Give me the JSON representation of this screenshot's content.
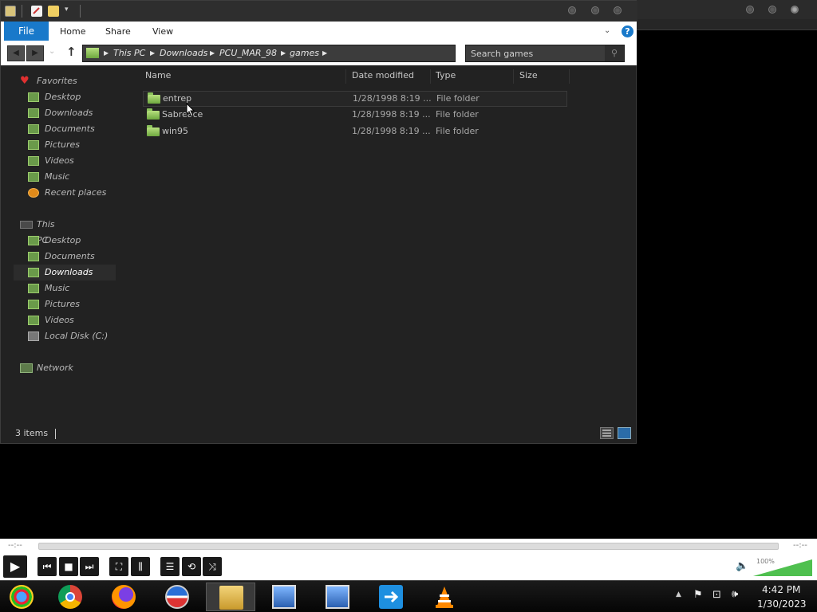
{
  "ribbon": {
    "file_tab": "File",
    "tabs": [
      "Home",
      "Share",
      "View"
    ],
    "help": "?"
  },
  "address": {
    "crumbs": [
      "This PC",
      "Downloads",
      "PCU_MAR_98",
      "games"
    ]
  },
  "search": {
    "placeholder": "Search games"
  },
  "nav": {
    "favorites_label": "Favorites",
    "favorites": [
      "Desktop",
      "Downloads",
      "Documents",
      "Pictures",
      "Videos",
      "Music",
      "Recent places"
    ],
    "thispc_label": "This PC",
    "thispc": [
      "Desktop",
      "Documents",
      "Downloads",
      "Music",
      "Pictures",
      "Videos",
      "Local Disk (C:)"
    ],
    "network_label": "Network",
    "selected": "Downloads"
  },
  "columns": {
    "name": "Name",
    "date": "Date modified",
    "type": "Type",
    "size": "Size"
  },
  "files": [
    {
      "name": "entrep",
      "date": "1/28/1998 8:19 ...",
      "type": "File folder"
    },
    {
      "name": "Sabreace",
      "date": "1/28/1998 8:19 ...",
      "type": "File folder"
    },
    {
      "name": "win95",
      "date": "1/28/1998 8:19 ...",
      "type": "File folder"
    }
  ],
  "status": {
    "count": "3 items"
  },
  "player": {
    "time_left": "--:--",
    "time_right": "--:--",
    "volume": "100%",
    "volume_level": 1.0
  },
  "tray": {
    "time": "4:42 PM",
    "date": "1/30/2023"
  },
  "colors": {
    "accent": "#1979ca",
    "window_bg": "#222222",
    "taskbar": "#111111"
  }
}
